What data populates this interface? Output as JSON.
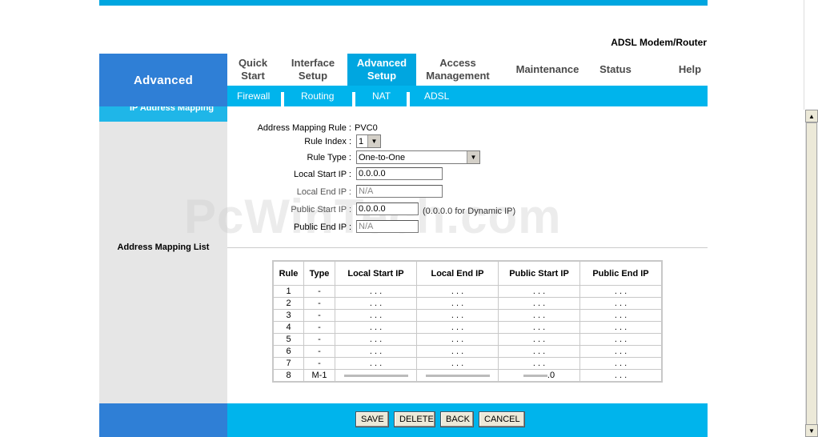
{
  "header": {
    "product": "ADSL Modem/Router",
    "section": "Advanced"
  },
  "menu": [
    {
      "label": "Quick\nStart",
      "active": false
    },
    {
      "label": "Interface\nSetup",
      "active": false
    },
    {
      "label": "Advanced\nSetup",
      "active": true
    },
    {
      "label": "Access\nManagement",
      "active": false
    },
    {
      "label": "Maintenance",
      "active": false
    },
    {
      "label": "Status",
      "active": false
    },
    {
      "label": "Help",
      "active": false
    }
  ],
  "submenu": [
    "Firewall",
    "Routing",
    "NAT",
    "ADSL"
  ],
  "section_title": "IP Address Mapping",
  "form": {
    "rule_label": "Address Mapping Rule :",
    "rule_value": "PVC0",
    "rule_index_label": "Rule Index :",
    "rule_index_value": "1",
    "rule_type_label": "Rule Type :",
    "rule_type_value": "One-to-One",
    "local_start_label": "Local Start IP :",
    "local_start_value": "0.0.0.0",
    "local_end_label": "Local End IP :",
    "local_end_value": "N/A",
    "public_start_label": "Public Start IP :",
    "public_start_value": "0.0.0.0",
    "public_start_hint": "(0.0.0.0 for Dynamic IP)",
    "public_end_label": "Public End IP :",
    "public_end_value": "N/A"
  },
  "list_label": "Address Mapping List",
  "table": {
    "headers": [
      "Rule",
      "Type",
      "Local Start IP",
      "Local End IP",
      "Public Start IP",
      "Public End IP"
    ],
    "rows": [
      [
        "1",
        "-",
        ". . .",
        ". . .",
        ". . .",
        ". . ."
      ],
      [
        "2",
        "-",
        ". . .",
        ". . .",
        ". . .",
        ". . ."
      ],
      [
        "3",
        "-",
        ". . .",
        ". . .",
        ". . .",
        ". . ."
      ],
      [
        "4",
        "-",
        ". . .",
        ". . .",
        ". . .",
        ". . ."
      ],
      [
        "5",
        "-",
        ". . .",
        ". . .",
        ". . .",
        ". . ."
      ],
      [
        "6",
        "-",
        ". . .",
        ". . .",
        ". . .",
        ". . ."
      ],
      [
        "7",
        "-",
        ". . .",
        ". . .",
        ". . .",
        ". . ."
      ],
      [
        "8",
        "M-1",
        "",
        "",
        ".0",
        ". . ."
      ]
    ]
  },
  "buttons": {
    "save": "SAVE",
    "delete": "DELETE",
    "back": "BACK",
    "cancel": "CANCEL"
  },
  "watermark": "PcWinTech.com",
  "icons": {
    "up": "scroll-up-arrow",
    "down": "scroll-down-arrow",
    "dropdown": "chevron-down"
  },
  "colors": {
    "accent": "#00a6e0",
    "sidebar": "#2f7fd6",
    "grey": "#e6e6e6"
  }
}
